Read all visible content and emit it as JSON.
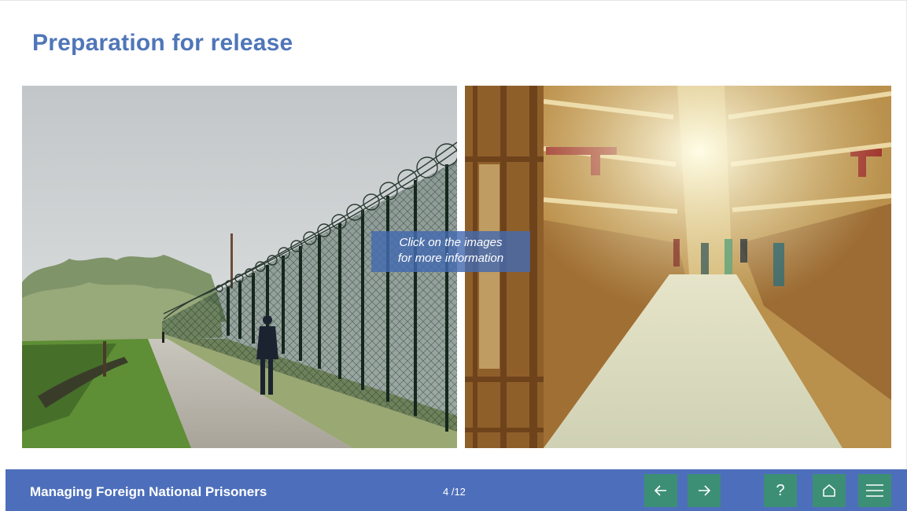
{
  "page": {
    "title": "Preparation for release"
  },
  "images": {
    "left": {
      "subject": "prison perimeter fence with razor wire and a person walking on a path"
    },
    "right": {
      "subject": "blurred prison cell block corridor with figures"
    }
  },
  "hint": {
    "line1": "Click on the images",
    "line2": "for more information"
  },
  "footer": {
    "course_title": "Managing Foreign National Prisoners",
    "page_counter": "4 /12"
  },
  "nav": {
    "prev_icon": "arrow-left-icon",
    "next_icon": "arrow-right-icon",
    "help_icon": "question-icon",
    "help_glyph": "?",
    "home_icon": "home-icon",
    "menu_icon": "hamburger-menu-icon"
  },
  "colors": {
    "title": "#4f76b8",
    "footer_bar": "#4d6fbb",
    "nav_button": "#3c8f74",
    "hint_box": "#446ab0"
  }
}
